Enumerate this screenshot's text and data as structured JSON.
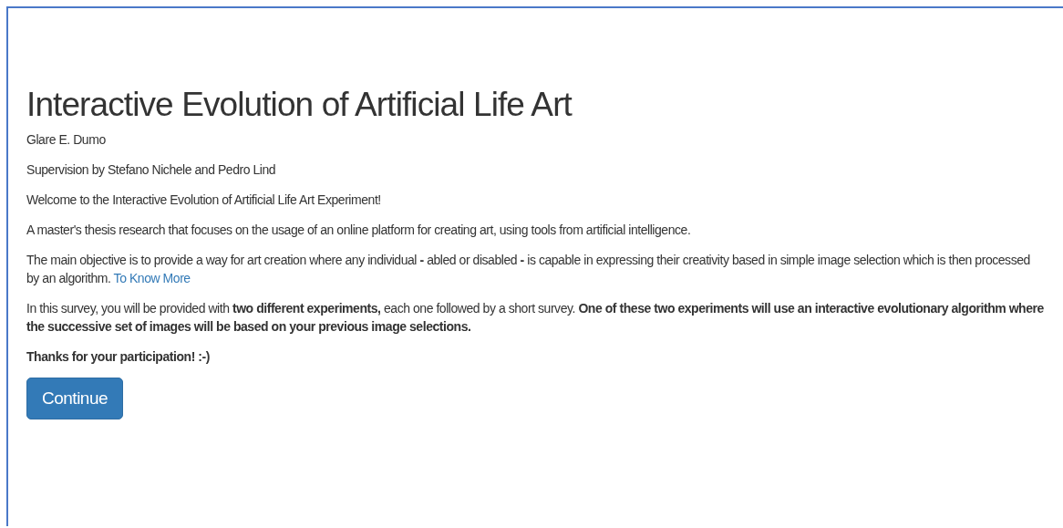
{
  "title": "Interactive Evolution of Artificial Life Art",
  "paragraphs": [
    {
      "text": "Glare E. Dumo"
    },
    {
      "text": "Supervision by Stefano Nichele and Pedro Lind"
    },
    {
      "text": "Welcome to the Interactive Evolution of Artificial Life Art Experiment!"
    },
    {
      "text": "A master's thesis research that focuses on the usage of an online platform for creating art, using tools from artificial intelligence."
    },
    {
      "text": "The main objective is to provide a way for art creation where any individual **-** abled or disabled **-** is capable in expressing their creativity based in simple image selection which is then processed by an algorithm.",
      "link": "To Know More"
    },
    {
      "text": "In this survey, you will be provided with **two different experiments,** each one followed by a short survey. **One of these two experiments will use an interactive evolutionary algorithm where the successive set of images will be based on your previous image selections.**"
    },
    {
      "text": "Thanks for your participation! :-)",
      "bold": true
    }
  ],
  "button": "Continue"
}
